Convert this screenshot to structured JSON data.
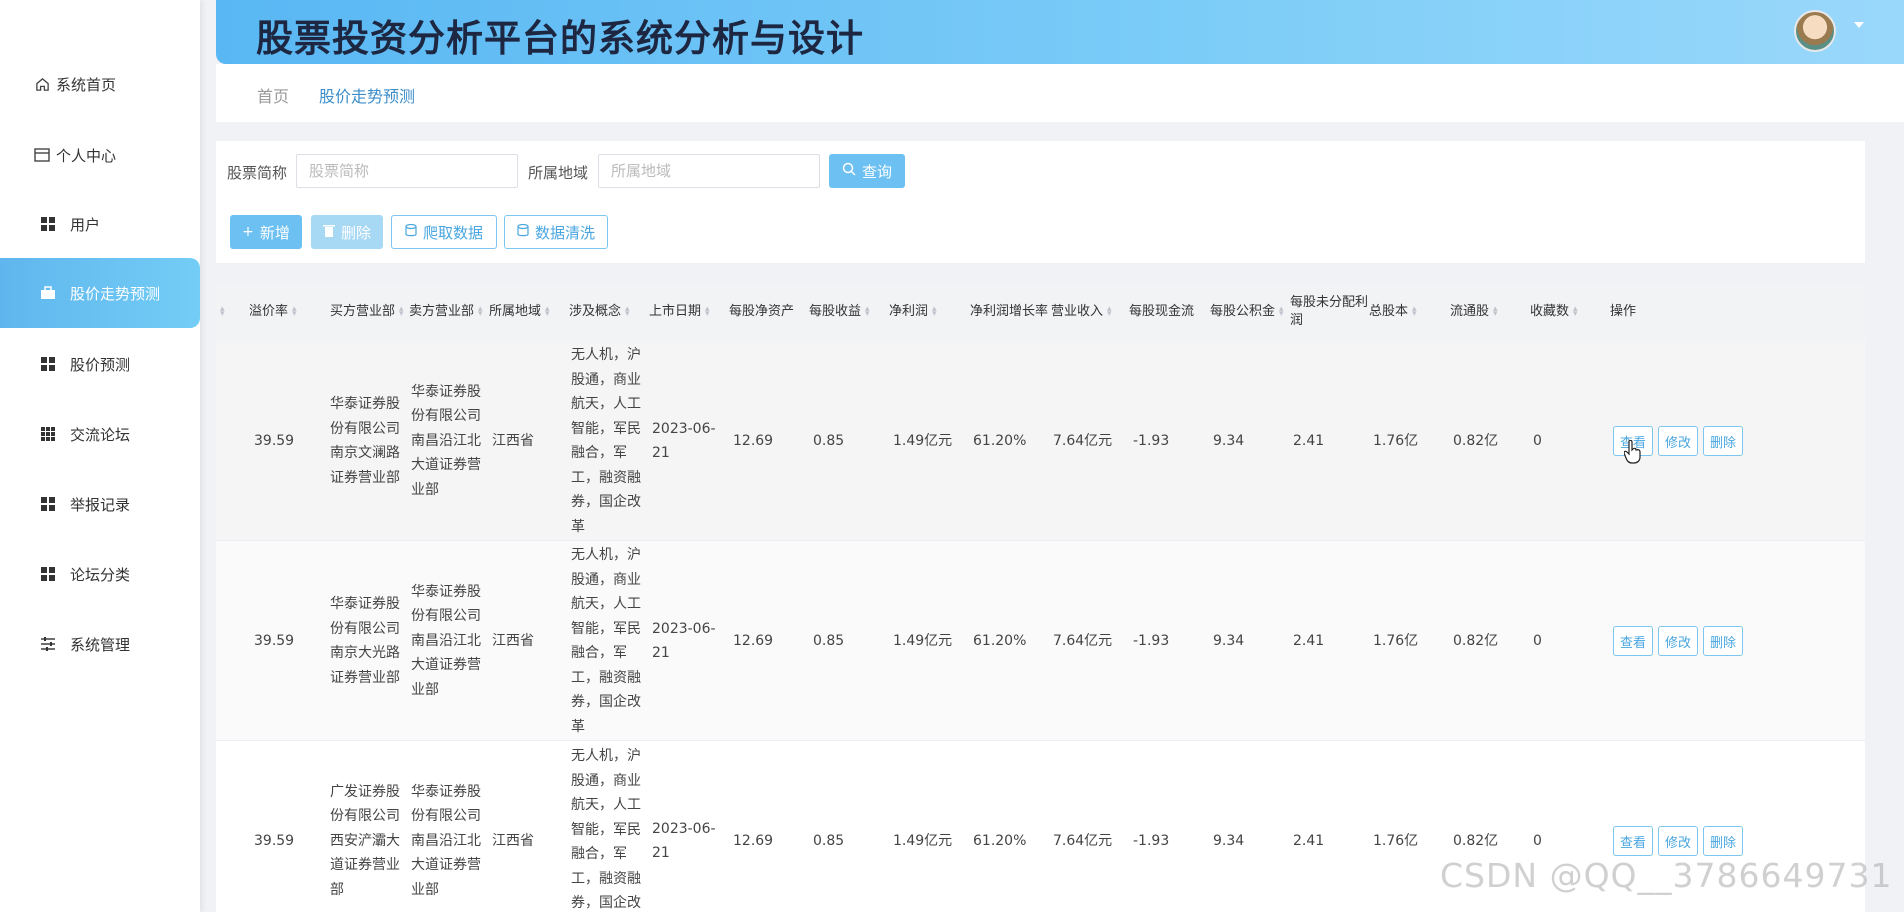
{
  "app": {
    "title": "股票投资分析平台的系统分析与设计"
  },
  "sidebar": {
    "items": [
      {
        "label": "系统首页",
        "icon": "home-icon"
      },
      {
        "label": "个人中心",
        "icon": "card-icon"
      },
      {
        "label": "用户",
        "icon": "grid-icon"
      },
      {
        "label": "股价走势预测",
        "icon": "briefcase-icon",
        "active": true
      },
      {
        "label": "股价预测",
        "icon": "grid-icon"
      },
      {
        "label": "交流论坛",
        "icon": "grid9-icon"
      },
      {
        "label": "举报记录",
        "icon": "grid-icon"
      },
      {
        "label": "论坛分类",
        "icon": "grid-icon"
      },
      {
        "label": "系统管理",
        "icon": "sliders-icon"
      }
    ]
  },
  "breadcrumb": {
    "home": "首页",
    "current": "股价走势预测"
  },
  "search": {
    "name_label": "股票简称",
    "name_placeholder": "股票简称",
    "region_label": "所属地域",
    "region_placeholder": "所属地域",
    "search_button": "查询"
  },
  "toolbar": {
    "add": "新增",
    "delete": "删除",
    "crawl": "爬取数据",
    "clean": "数据清洗"
  },
  "table": {
    "headers": [
      "溢价率",
      "买方营业部",
      "卖方营业部",
      "所属地域",
      "涉及概念",
      "上市日期",
      "每股净资产",
      "每股收益",
      "净利润",
      "净利润增长率",
      "营业收入",
      "每股现金流",
      "每股公积金",
      "每股未分配利润",
      "总股本",
      "流通股",
      "收藏数",
      "操作"
    ],
    "rows": [
      {
        "premium": "39.59",
        "buyer": "华泰证券股份有限公司南京文澜路证券营业部",
        "seller": "华泰证券股份有限公司南昌沿江北大道证券营业部",
        "region": "江西省",
        "concept": "无人机，沪股通，商业航天，人工智能，军民融合，军工，融资融券，国企改革",
        "date": "2023-06-21",
        "nav": "12.69",
        "eps": "0.85",
        "profit": "1.49亿元",
        "growth": "61.20%",
        "revenue": "7.64亿元",
        "cashflow": "-1.93",
        "reserve": "9.34",
        "undistributed": "2.41",
        "total_shares": "1.76亿",
        "float_shares": "0.82亿",
        "favorites": "0"
      },
      {
        "premium": "39.59",
        "buyer": "华泰证券股份有限公司南京大光路证券营业部",
        "seller": "华泰证券股份有限公司南昌沿江北大道证券营业部",
        "region": "江西省",
        "concept": "无人机，沪股通，商业航天，人工智能，军民融合，军工，融资融券，国企改革",
        "date": "2023-06-21",
        "nav": "12.69",
        "eps": "0.85",
        "profit": "1.49亿元",
        "growth": "61.20%",
        "revenue": "7.64亿元",
        "cashflow": "-1.93",
        "reserve": "9.34",
        "undistributed": "2.41",
        "total_shares": "1.76亿",
        "float_shares": "0.82亿",
        "favorites": "0"
      },
      {
        "premium": "39.59",
        "buyer": "广发证券股份有限公司西安浐灞大道证券营业部",
        "seller": "华泰证券股份有限公司南昌沿江北大道证券营业部",
        "region": "江西省",
        "concept": "无人机，沪股通，商业航天，人工智能，军民融合，军工，融资融券，国企改",
        "date": "2023-06-21",
        "nav": "12.69",
        "eps": "0.85",
        "profit": "1.49亿元",
        "growth": "61.20%",
        "revenue": "7.64亿元",
        "cashflow": "-1.93",
        "reserve": "9.34",
        "undistributed": "2.41",
        "total_shares": "1.76亿",
        "float_shares": "0.82亿",
        "favorites": "0"
      }
    ],
    "actions": {
      "view": "查看",
      "edit": "修改",
      "delete": "删除"
    }
  },
  "watermark": "CSDN @QQ__3786649731",
  "colors": {
    "accent": "#6cc0f2",
    "header_start": "#59b7f3",
    "link": "#3c8dc9"
  }
}
